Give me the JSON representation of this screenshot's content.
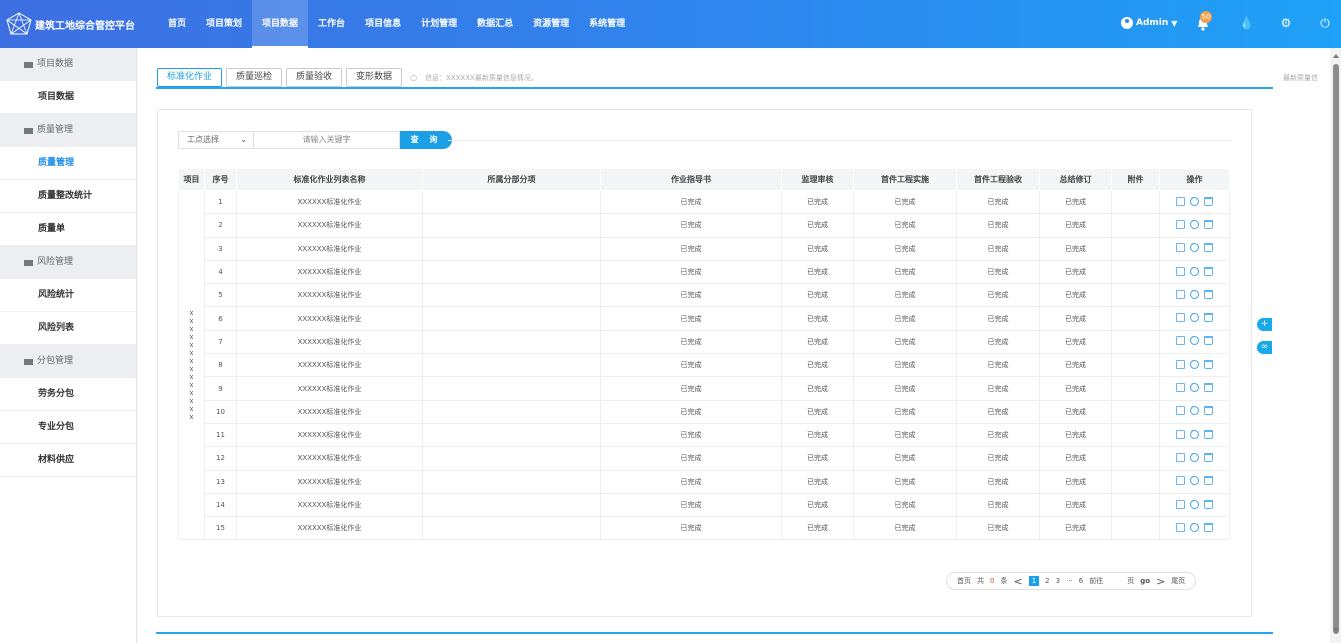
{
  "app": {
    "title": "建筑工地综合管控平台"
  },
  "nav": [
    {
      "label": "首页",
      "active": false
    },
    {
      "label": "项目策划",
      "active": false
    },
    {
      "label": "项目数据",
      "active": true
    },
    {
      "label": "工作台",
      "active": false
    },
    {
      "label": "项目信息",
      "active": false
    },
    {
      "label": "计划管理",
      "active": false
    },
    {
      "label": "数据汇总",
      "active": false
    },
    {
      "label": "资源管理",
      "active": false
    },
    {
      "label": "系统管理",
      "active": false
    }
  ],
  "user": {
    "name": "Admin",
    "notifications": "50"
  },
  "sidebar": {
    "g1": "项目数据",
    "i1": "项目数据",
    "g2": "质量管理",
    "i2": "质量管理",
    "i3": "质量整改统计",
    "i4": "质量单",
    "g3": "风险管理",
    "i5": "风险统计",
    "i6": "风险列表",
    "g4": "分包管理",
    "i7": "劳务分包",
    "i8": "专业分包",
    "i9": "材料供应"
  },
  "tabs": [
    "标准化作业",
    "质量巡检",
    "质量验收",
    "变形数据"
  ],
  "tab_info": "信息：XXXXXX最新质量信息情况。",
  "tab_right": "最新质量信",
  "search": {
    "select_label": "工点选择",
    "placeholder": "请输入关键字",
    "button": "查 询"
  },
  "table": {
    "headers": [
      "项目",
      "序号",
      "标准化作业列表名称",
      "所属分部分项",
      "作业指导书",
      "监理审核",
      "首件工程实施",
      "首件工程验收",
      "总结修订",
      "附件",
      "操作"
    ],
    "project_cell": "x\nx\nx\nx\nx\nx\nx\nx\nx\nx\nx\nx\nx\nx",
    "rows": [
      {
        "no": "1",
        "name": "XXXXXX标准化作业",
        "part": "",
        "guide": "已完成",
        "review": "已完成",
        "impl": "已完成",
        "accept": "已完成",
        "summary": "已完成",
        "attach": ""
      },
      {
        "no": "2",
        "name": "XXXXXX标准化作业",
        "part": "",
        "guide": "已完成",
        "review": "已完成",
        "impl": "已完成",
        "accept": "已完成",
        "summary": "已完成",
        "attach": ""
      },
      {
        "no": "3",
        "name": "XXXXXX标准化作业",
        "part": "",
        "guide": "已完成",
        "review": "已完成",
        "impl": "已完成",
        "accept": "已完成",
        "summary": "已完成",
        "attach": ""
      },
      {
        "no": "4",
        "name": "XXXXXX标准化作业",
        "part": "",
        "guide": "已完成",
        "review": "已完成",
        "impl": "已完成",
        "accept": "已完成",
        "summary": "已完成",
        "attach": ""
      },
      {
        "no": "5",
        "name": "XXXXXX标准化作业",
        "part": "",
        "guide": "已完成",
        "review": "已完成",
        "impl": "已完成",
        "accept": "已完成",
        "summary": "已完成",
        "attach": ""
      },
      {
        "no": "6",
        "name": "XXXXXX标准化作业",
        "part": "",
        "guide": "已完成",
        "review": "已完成",
        "impl": "已完成",
        "accept": "已完成",
        "summary": "已完成",
        "attach": ""
      },
      {
        "no": "7",
        "name": "XXXXXX标准化作业",
        "part": "",
        "guide": "已完成",
        "review": "已完成",
        "impl": "已完成",
        "accept": "已完成",
        "summary": "已完成",
        "attach": ""
      },
      {
        "no": "8",
        "name": "XXXXXX标准化作业",
        "part": "",
        "guide": "已完成",
        "review": "已完成",
        "impl": "已完成",
        "accept": "已完成",
        "summary": "已完成",
        "attach": ""
      },
      {
        "no": "9",
        "name": "XXXXXX标准化作业",
        "part": "",
        "guide": "已完成",
        "review": "已完成",
        "impl": "已完成",
        "accept": "已完成",
        "summary": "已完成",
        "attach": ""
      },
      {
        "no": "10",
        "name": "XXXXXX标准化作业",
        "part": "",
        "guide": "已完成",
        "review": "已完成",
        "impl": "已完成",
        "accept": "已完成",
        "summary": "已完成",
        "attach": ""
      },
      {
        "no": "11",
        "name": "XXXXXX标准化作业",
        "part": "",
        "guide": "已完成",
        "review": "已完成",
        "impl": "已完成",
        "accept": "已完成",
        "summary": "已完成",
        "attach": ""
      },
      {
        "no": "12",
        "name": "XXXXXX标准化作业",
        "part": "",
        "guide": "已完成",
        "review": "已完成",
        "impl": "已完成",
        "accept": "已完成",
        "summary": "已完成",
        "attach": ""
      },
      {
        "no": "13",
        "name": "XXXXXX标准化作业",
        "part": "",
        "guide": "已完成",
        "review": "已完成",
        "impl": "已完成",
        "accept": "已完成",
        "summary": "已完成",
        "attach": ""
      },
      {
        "no": "14",
        "name": "XXXXXX标准化作业",
        "part": "",
        "guide": "已完成",
        "review": "已完成",
        "impl": "已完成",
        "accept": "已完成",
        "summary": "已完成",
        "attach": ""
      },
      {
        "no": "15",
        "name": "XXXXXX标准化作业",
        "part": "",
        "guide": "已完成",
        "review": "已完成",
        "impl": "已完成",
        "accept": "已完成",
        "summary": "已完成",
        "attach": ""
      }
    ]
  },
  "pager": {
    "first": "首页",
    "total_prefix": "共",
    "total": "0",
    "total_suffix": "条",
    "prev": "<",
    "pages": [
      "1",
      "2",
      "3"
    ],
    "ellipsis": "···",
    "last_page": "6",
    "goto": "前往",
    "page_word": "页",
    "go": "go",
    "next": ">",
    "end": "尾页"
  },
  "colors": {
    "accent": "#1ba0e6",
    "header_start": "#3d6fe2",
    "header_end": "#1ea1f7"
  }
}
